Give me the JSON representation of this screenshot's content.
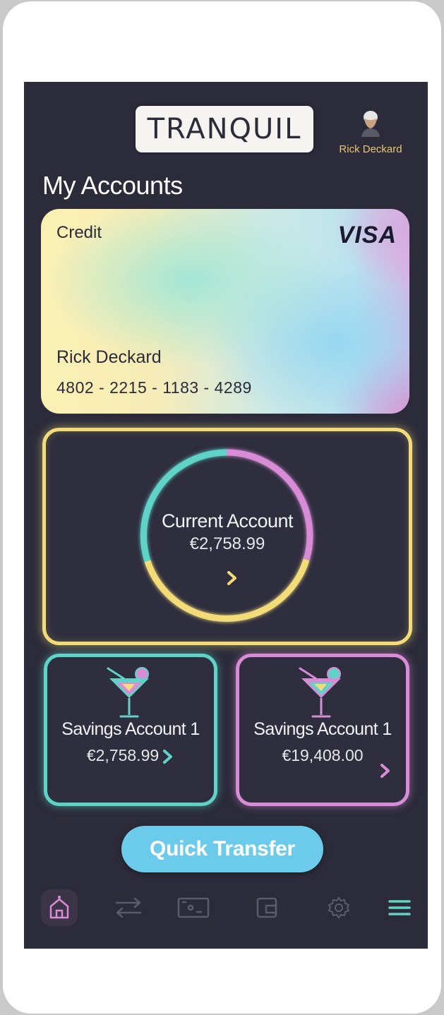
{
  "app": {
    "logo_text": "TRANQUIL",
    "user_name": "Rick Deckard"
  },
  "page": {
    "title": "My Accounts"
  },
  "credit_card": {
    "type": "Credit",
    "brand": "VISA",
    "holder": "Rick Deckard",
    "number": "4802 - 2215 - 1183 - 4289"
  },
  "current_account": {
    "name": "Current Account",
    "balance": "€2,758.99"
  },
  "savings": [
    {
      "name": "Savings Account 1",
      "balance": "€2,758.99",
      "color": "#5fd3c8"
    },
    {
      "name": "Savings Account 1",
      "balance": "€19,408.00",
      "color": "#d98cd6"
    }
  ],
  "actions": {
    "quick_transfer": "Quick Transfer"
  },
  "nav": {
    "items": [
      "home-icon",
      "transfer-icon",
      "cash-icon",
      "wallet-icon",
      "settings-icon",
      "menu-icon"
    ],
    "active": "home-icon"
  },
  "colors": {
    "background": "#2b2b3a",
    "yellow": "#f3dc78",
    "teal": "#5fd3c8",
    "pink": "#d98cd6",
    "blue": "#6ccbea"
  }
}
